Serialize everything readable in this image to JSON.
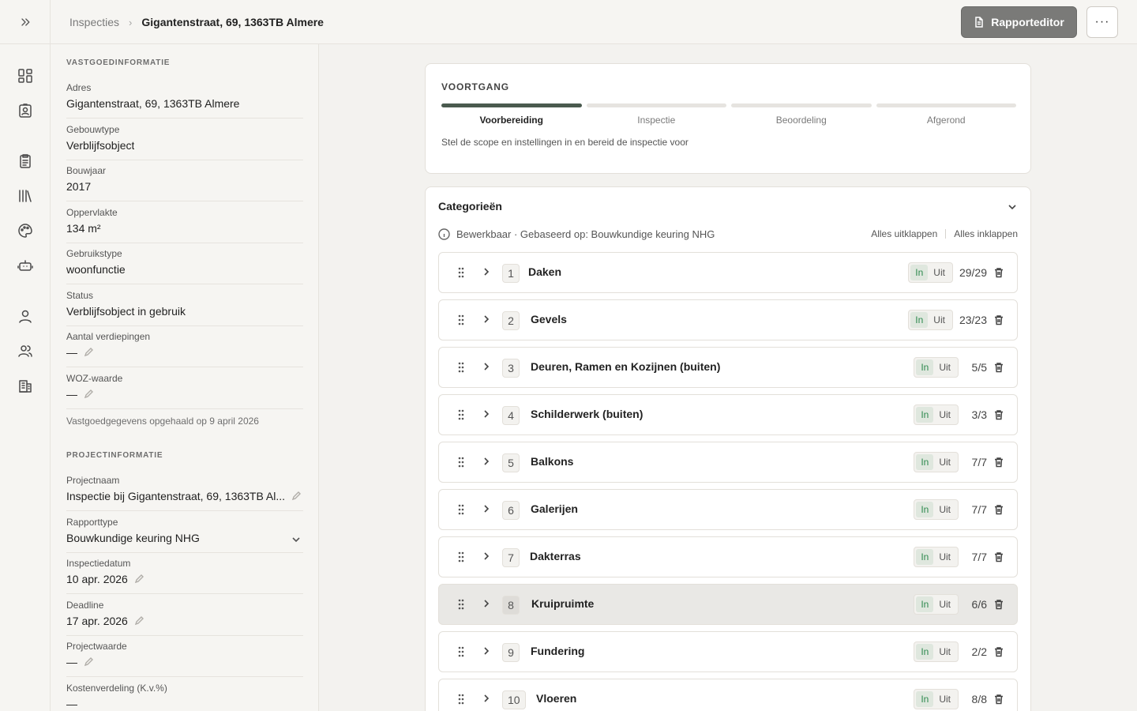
{
  "breadcrumb": {
    "parent": "Inspecties",
    "current": "Gigantenstraat, 69, 1363TB Almere"
  },
  "header": {
    "report_button": "Rapporteditor",
    "more_button": "···"
  },
  "rail": {
    "icons": [
      "expand-icon",
      "dashboard-icon",
      "id-badge-icon",
      "clipboard-icon",
      "library-icon",
      "palette-icon",
      "robot-icon",
      "user-icon",
      "users-icon",
      "building-icon"
    ]
  },
  "property": {
    "section_title": "VASTGOEDINFORMATIE",
    "fields": [
      {
        "label": "Adres",
        "value": "Gigantenstraat, 69, 1363TB Almere"
      },
      {
        "label": "Gebouwtype",
        "value": "Verblijfsobject"
      },
      {
        "label": "Bouwjaar",
        "value": "2017"
      },
      {
        "label": "Oppervlakte",
        "value": "134 m²"
      },
      {
        "label": "Gebruikstype",
        "value": "woonfunctie"
      },
      {
        "label": "Status",
        "value": "Verblijfsobject in gebruik"
      },
      {
        "label": "Aantal verdiepingen",
        "value": "—"
      },
      {
        "label": "WOZ-waarde",
        "value": "—"
      }
    ],
    "fetched_note": "Vastgoedgegevens opgehaald op 9 april 2026"
  },
  "project": {
    "section_title": "PROJECTINFORMATIE",
    "fields": [
      {
        "label": "Projectnaam",
        "value": "Inspectie bij Gigantenstraat, 69, 1363TB Al..."
      },
      {
        "label": "Rapporttype",
        "value": "Bouwkundige keuring NHG"
      },
      {
        "label": "Inspectiedatum",
        "value": "10 apr. 2026"
      },
      {
        "label": "Deadline",
        "value": "17 apr. 2026"
      },
      {
        "label": "Projectwaarde",
        "value": "—"
      },
      {
        "label": "Kostenverdeling (K.v.%)",
        "value": "—"
      }
    ]
  },
  "progress": {
    "title": "VOORTGANG",
    "steps": [
      "Voorbereiding",
      "Inspectie",
      "Beoordeling",
      "Afgerond"
    ],
    "active_step": 0,
    "description": "Stel de scope en instellingen in en bereid de inspectie voor",
    "accent_color": "#4a5a4e"
  },
  "categories": {
    "title": "Categorieën",
    "info": "Bewerkbaar · Gebaseerd op: Bouwkundige keuring NHG",
    "expand_all": "Alles uitklappen",
    "collapse_all": "Alles inklappen",
    "toggle_in": "In",
    "toggle_out": "Uit",
    "items": [
      {
        "num": "1",
        "name": "Daken",
        "count": "29/29"
      },
      {
        "num": "2",
        "name": "Gevels",
        "count": "23/23"
      },
      {
        "num": "3",
        "name": "Deuren, Ramen en Kozijnen (buiten)",
        "count": "5/5"
      },
      {
        "num": "4",
        "name": "Schilderwerk (buiten)",
        "count": "3/3"
      },
      {
        "num": "5",
        "name": "Balkons",
        "count": "7/7"
      },
      {
        "num": "6",
        "name": "Galerijen",
        "count": "7/7"
      },
      {
        "num": "7",
        "name": "Dakterras",
        "count": "7/7"
      },
      {
        "num": "8",
        "name": "Kruipruimte",
        "count": "6/6"
      },
      {
        "num": "9",
        "name": "Fundering",
        "count": "2/2"
      },
      {
        "num": "10",
        "name": "Vloeren",
        "count": "8/8"
      }
    ]
  }
}
